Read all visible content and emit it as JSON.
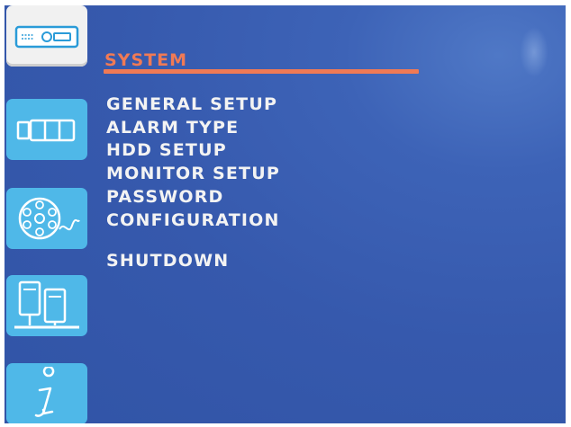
{
  "sidebar": {
    "items": [
      {
        "icon": "dvr-recorder-icon",
        "active": true
      },
      {
        "icon": "camera-icon",
        "active": false
      },
      {
        "icon": "film-reel-icon",
        "active": false
      },
      {
        "icon": "network-computers-icon",
        "active": false
      },
      {
        "icon": "info-icon",
        "active": false
      }
    ]
  },
  "main": {
    "title": "SYSTEM",
    "menu": [
      "GENERAL SETUP",
      "ALARM TYPE",
      "HDD SETUP",
      "MONITOR SETUP",
      "PASSWORD",
      "CONFIGURATION"
    ],
    "shutdown": "SHUTDOWN"
  },
  "colors": {
    "background": "#3659ad",
    "accent": "#f07a55",
    "sidebar_button": "#4fb8e8",
    "sidebar_active": "#f1f1f1",
    "text": "#f3f3f3"
  }
}
